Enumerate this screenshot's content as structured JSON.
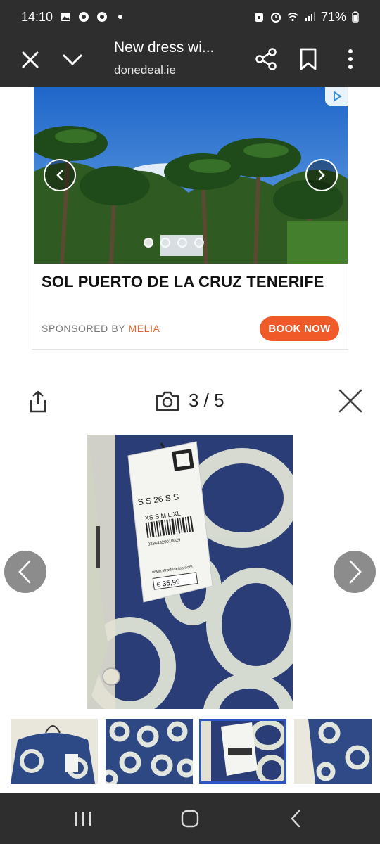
{
  "status_bar": {
    "time": "14:10",
    "battery": "71%",
    "left_icons": [
      "gallery-icon",
      "chrome-icon",
      "chrome-icon",
      "dot-icon"
    ],
    "right_icons": [
      "lock-icon",
      "alarm-icon",
      "wifi-icon",
      "signal-icon",
      "battery-icon"
    ]
  },
  "toolbar": {
    "title": "New dress wi...",
    "url": "donedeal.ie",
    "icons": [
      "close-icon",
      "chevron-down-icon",
      "share-icon",
      "bookmark-icon",
      "more-vert-icon"
    ]
  },
  "ad": {
    "headline": "SOL PUERTO DE LA CRUZ TENERIFE",
    "sponsored_prefix": "SPONSORED BY",
    "sponsor_brand": "MELIA",
    "cta": "BOOK NOW",
    "carousel_dots": 4,
    "active_dot": 0,
    "cta_color": "#f05a28",
    "brand_color": "#e0672e"
  },
  "gallery": {
    "counter": "3 / 5",
    "thumbnail_count": 4,
    "selected_thumbnail": 2,
    "selected_border_color": "#2b56c4"
  },
  "price_tag": {
    "sizes_header": "S  S  26  S  S",
    "size_row": "XS  S  M  L  XL",
    "barcode_number": "02364920010029",
    "website": "www.stradivarius.com",
    "price": "€ 35,99"
  }
}
